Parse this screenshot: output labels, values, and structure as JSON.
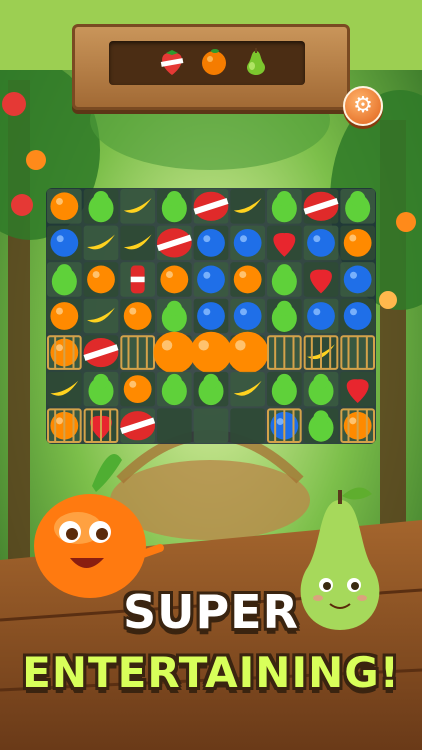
{
  "goal": {
    "items": [
      {
        "name": "strawberry-icon",
        "color": "#e53935"
      },
      {
        "name": "orange-icon",
        "color": "#f57c00"
      },
      {
        "name": "pear-icon",
        "color": "#7cc62e"
      }
    ]
  },
  "settings": {
    "icon": "gear-icon",
    "glyph": "⚙"
  },
  "board": {
    "rows": [
      [
        "orange",
        "pear",
        "banana",
        "pear",
        "bomb",
        "banana",
        "pear",
        "bomb",
        "pear"
      ],
      [
        "blueberry",
        "banana",
        "banana",
        "bomb",
        "blueberry",
        "blueberry",
        "strawberry",
        "blueberry",
        "orange"
      ],
      [
        "pear",
        "orange",
        "rocket",
        "orange",
        "blueberry",
        "orange",
        "pear",
        "strawberry",
        "blueberry"
      ],
      [
        "orange",
        "banana",
        "orange",
        "pear",
        "blueberry",
        "blueberry",
        "pear",
        "blueberry",
        "blueberry"
      ],
      [
        "cage-orange",
        "bomb",
        "cage-empty",
        "big-orange",
        "big-orange",
        "big-orange",
        "cage-empty",
        "cage-banana",
        "cage-empty"
      ],
      [
        "banana",
        "pear",
        "orange",
        "pear",
        "pear",
        "banana",
        "pear",
        "pear",
        "strawberry"
      ],
      [
        "cage-orange",
        "cage-strawberry",
        "bomb",
        "empty",
        "empty",
        "empty",
        "cage-blueberry",
        "pear",
        "cage-orange"
      ]
    ]
  },
  "colors": {
    "orange": "#ff8a00",
    "pear": "#5fd13a",
    "banana": "#ffd21f",
    "blueberry": "#1f6fe8",
    "strawberry": "#e8262e",
    "accent": "#d8ff5a"
  },
  "characters": [
    {
      "name": "orange-character",
      "color": "#ff7a10"
    },
    {
      "name": "pear-character",
      "color": "#a6d95b"
    }
  ],
  "tagline": {
    "line1": "SUPER",
    "line2": "ENTERTAINING!"
  }
}
